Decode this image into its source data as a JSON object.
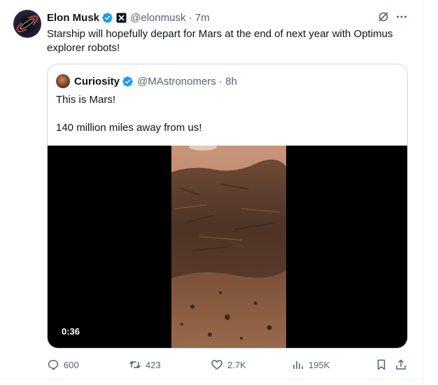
{
  "post": {
    "author_name": "Elon Musk",
    "handle": "@elonmusk",
    "time": "7m",
    "text_line1": "Starship will hopefully depart for Mars at the end of next year with Optimus",
    "text_line2": "explorer robots!"
  },
  "quote": {
    "author_name": "Curiosity",
    "handle": "@MAstronomers",
    "time": "8h",
    "line1": "This is Mars!",
    "line2": "140 million miles away from us!",
    "video_duration": "0:36"
  },
  "actions": {
    "replies": "600",
    "reposts": "423",
    "likes": "2.7K",
    "views": "195K"
  },
  "colors": {
    "verified": "#1d9bf0",
    "text": "#0f1419",
    "muted": "#536471",
    "border": "#cfd9de"
  }
}
